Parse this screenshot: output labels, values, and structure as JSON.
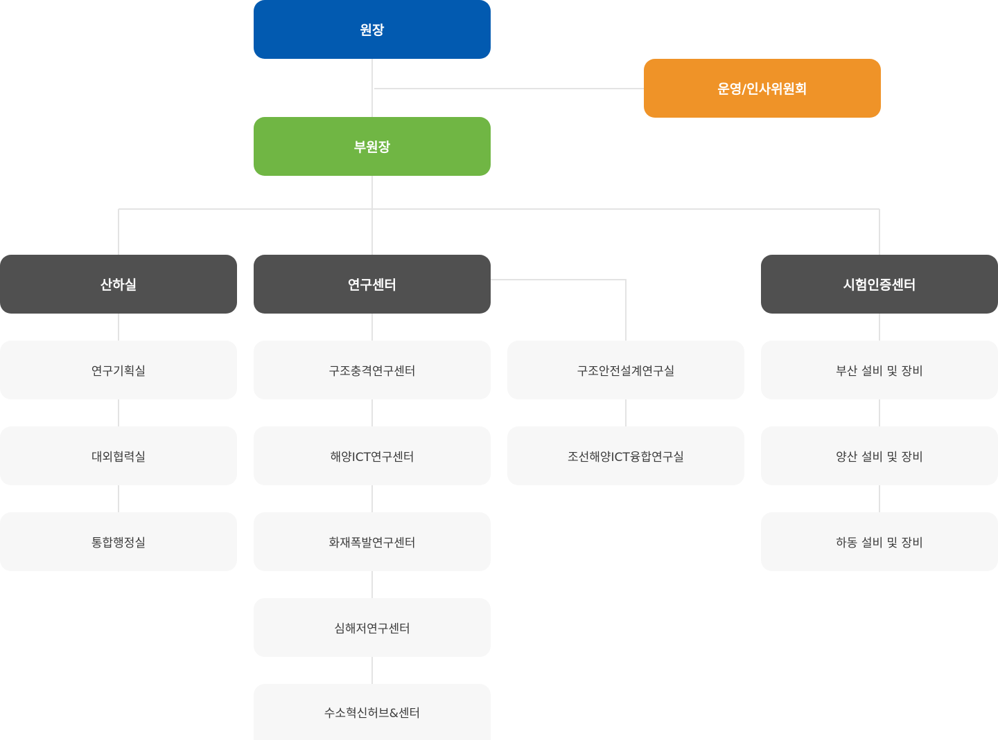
{
  "colors": {
    "director": "#025ab0",
    "committee": "#ef9328",
    "vice_director": "#70b644",
    "department": "#505050",
    "unit_background": "#f7f7f7",
    "connector": "#e3e3e3"
  },
  "org": {
    "director": "원장",
    "committee": "운영/인사위원회",
    "vice_director": "부원장",
    "departments": [
      {
        "name": "산하실",
        "units": [
          "연구기획실",
          "대외협력실",
          "통합행정실"
        ]
      },
      {
        "name": "연구센터",
        "units": [
          "구조충격연구센터",
          "해양ICT연구센터",
          "화재폭발연구센터",
          "심해저연구센터",
          "수소혁신허브&센터"
        ],
        "labs": [
          "구조안전설계연구실",
          "조선해양ICT융합연구실"
        ]
      },
      {
        "name": "시험인증센터",
        "units": [
          "부산 설비 및 장비",
          "양산 설비 및 장비",
          "하동 설비 및 장비"
        ]
      }
    ]
  }
}
